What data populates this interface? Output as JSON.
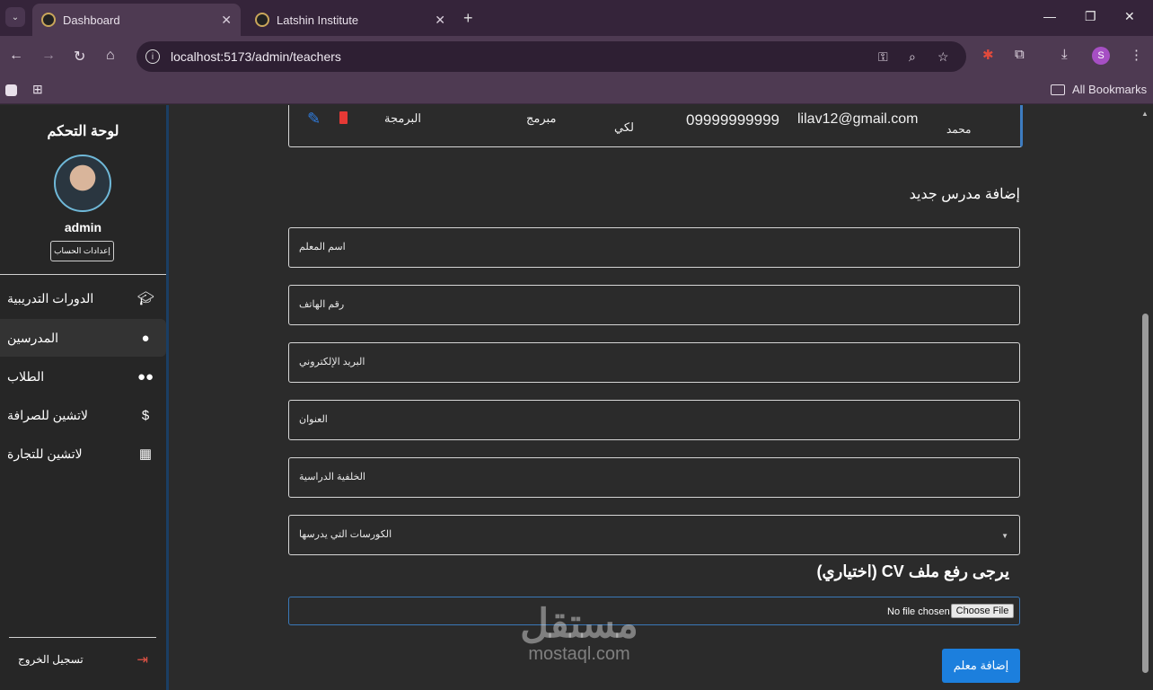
{
  "browser": {
    "tabs": [
      {
        "title": "Dashboard",
        "active": true
      },
      {
        "title": "Latshin Institute",
        "active": false
      }
    ],
    "url": "localhost:5173/admin/teachers",
    "bookmarks_label": "All Bookmarks",
    "profile_initial": "S"
  },
  "sidebar": {
    "title": "لوحة التحكم",
    "username": "admin",
    "account_settings": "إعدادات الحساب",
    "items": [
      {
        "label": "الدورات التدريبية",
        "icon": "graduation-cap-icon",
        "active": false
      },
      {
        "label": "المدرسين",
        "icon": "person-icon",
        "active": true
      },
      {
        "label": "الطلاب",
        "icon": "people-icon",
        "active": false
      },
      {
        "label": "لاتشين للصرافة",
        "icon": "currency-exchange-icon",
        "active": false
      },
      {
        "label": "لاتشين للتجارة",
        "icon": "building-icon",
        "active": false
      }
    ],
    "logout": "تسجيل الخروج"
  },
  "teacher_row": {
    "name": "محمد",
    "email": "lilav12@gmail.com",
    "phone": "09999999999",
    "address": "لكي",
    "background": "مبرمج",
    "courses": "البرمجة"
  },
  "form": {
    "title": "إضافة مدرس جديد",
    "fields": {
      "name": "اسم المعلم",
      "phone": "رقم الهاتف",
      "email": "البريد الإلكتروني",
      "address": "العنوان",
      "background": "الخلفية الدراسية",
      "courses": "الكورسات التي يدرسها"
    },
    "cv_label": "يرجى رفع ملف CV (اختياري)",
    "file_status": "No file chosen",
    "file_button": "Choose File",
    "submit": "إضافة معلم"
  },
  "watermark": {
    "arabic": "مستقل",
    "latin": "mostaql.com"
  },
  "colors": {
    "accent": "#1c7fdd",
    "sidebar_border": "#1b3e63",
    "logout": "#e05245"
  }
}
